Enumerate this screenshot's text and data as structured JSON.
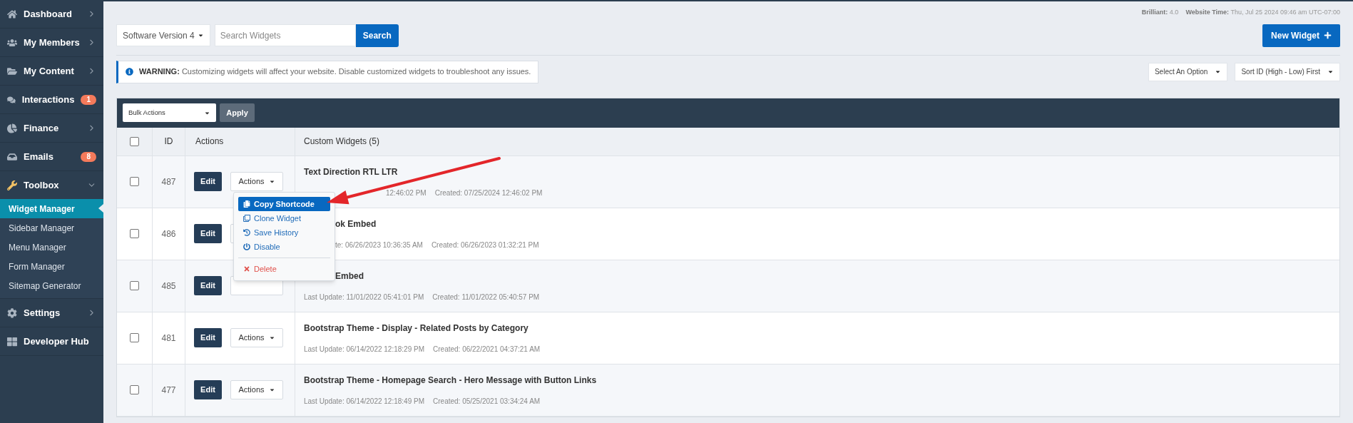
{
  "sidebar": {
    "items": [
      {
        "label": "Dashboard",
        "expanded": false
      },
      {
        "label": "My Members",
        "expanded": false
      },
      {
        "label": "My Content",
        "expanded": false
      },
      {
        "label": "Interactions",
        "badge": "1"
      },
      {
        "label": "Finance",
        "expanded": false
      },
      {
        "label": "Emails",
        "badge": "8"
      },
      {
        "label": "Toolbox",
        "expanded": true,
        "children": [
          {
            "label": "Widget Manager",
            "selected": true
          },
          {
            "label": "Sidebar Manager",
            "selected": false
          },
          {
            "label": "Menu Manager",
            "selected": false
          },
          {
            "label": "Form Manager",
            "selected": false
          },
          {
            "label": "Sitemap Generator",
            "selected": false
          }
        ]
      },
      {
        "label": "Settings",
        "expanded": false
      },
      {
        "label": "Developer Hub"
      }
    ]
  },
  "meta": {
    "version_label": "Brilliant:",
    "version": "4.0",
    "time_label": "Website Time:",
    "time": "Thu, Jul 25 2024 09:46 am UTC-07:00"
  },
  "toolbar": {
    "version_select": "Software Version 4",
    "search": {
      "placeholder": "Search Widgets"
    },
    "search_button": "Search",
    "new_button": "New Widget"
  },
  "warning": {
    "label": "WARNING:",
    "text": "Customizing widgets will affect your website. Disable customized widgets to troubleshoot any issues."
  },
  "filters": [
    "Select An Option",
    "Sort ID (High - Low) First"
  ],
  "bulk": {
    "select": "Bulk Actions",
    "apply": "Apply"
  },
  "table": {
    "header_checked": false,
    "columns": [
      "ID",
      "Actions",
      "Custom Widgets (5)"
    ],
    "rows": [
      {
        "checked": false,
        "id": "487",
        "edit": "Edit",
        "actions": "Actions",
        "title": "Text Direction RTL LTR",
        "updated": "12:46:02 PM",
        "created": "Created: 07/25/2024 12:46:02 PM"
      },
      {
        "checked": false,
        "id": "486",
        "edit": "Edit",
        "title": "ok Embed",
        "updated": "te: 06/26/2023 10:36:35 AM",
        "created": "Created: 06/26/2023 01:32:21 PM"
      },
      {
        "checked": false,
        "id": "485",
        "edit": "Edit",
        "title": "Embed",
        "updated": "Last Update: 11/01/2022 05:41:01 PM",
        "created": "Created: 11/01/2022 05:40:57 PM"
      },
      {
        "checked": false,
        "id": "481",
        "edit": "Edit",
        "actions": "Actions",
        "title": "Bootstrap Theme - Display - Related Posts by Category",
        "updated": "Last Update: 06/14/2022 12:18:29 PM",
        "created": "Created: 06/22/2021 04:37:21 AM"
      },
      {
        "checked": false,
        "id": "477",
        "edit": "Edit",
        "actions": "Actions",
        "title": "Bootstrap Theme - Homepage Search - Hero Message with Button Links",
        "updated": "Last Update: 06/14/2022 12:18:49 PM",
        "created": "Created: 05/25/2021 03:34:24 AM"
      }
    ]
  },
  "menu": {
    "items": [
      {
        "kind": "copy",
        "label": "Copy Shortcode",
        "selected": true
      },
      {
        "kind": "clone",
        "label": "Clone Widget",
        "selected": false
      },
      {
        "kind": "history",
        "label": "Save History",
        "selected": false
      },
      {
        "kind": "disable",
        "label": "Disable",
        "selected": false
      },
      {
        "kind": "delete",
        "label": "Delete",
        "selected": false
      }
    ]
  }
}
